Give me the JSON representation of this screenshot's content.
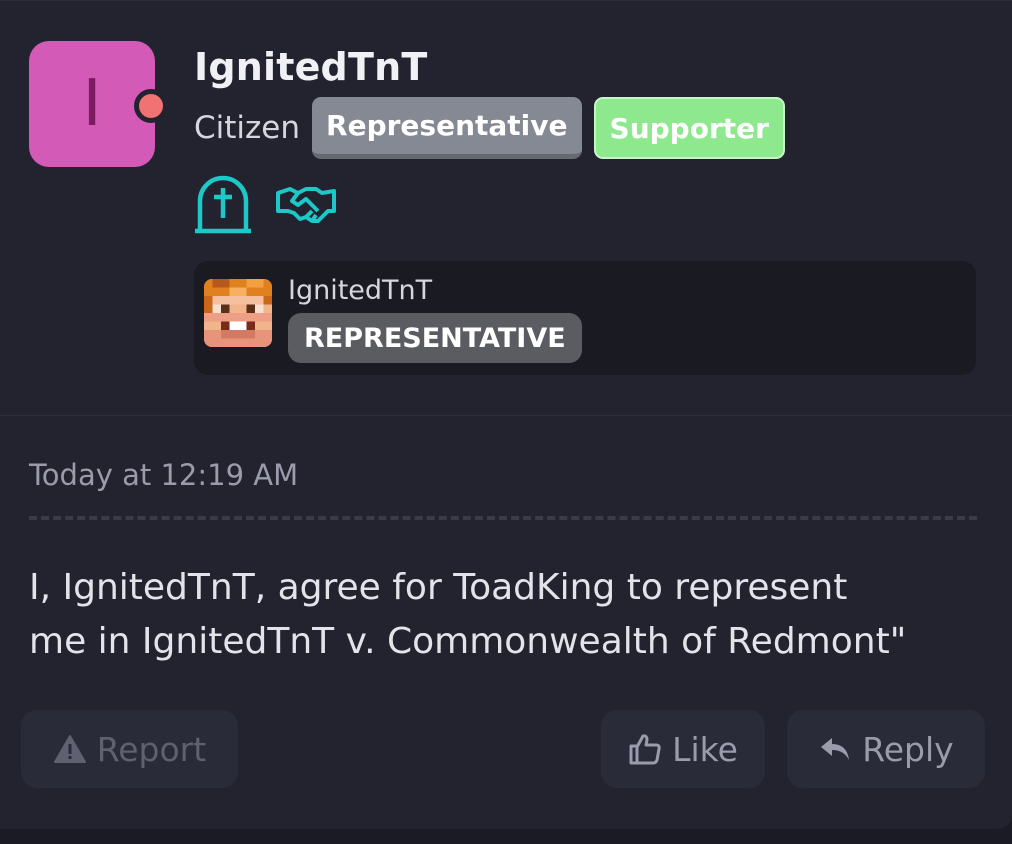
{
  "user": {
    "avatar_letter": "I",
    "username": "IgnitedTnT",
    "rank": "Citizen",
    "badges": [
      {
        "label": "Representative",
        "color": "#858993"
      },
      {
        "label": "Supporter",
        "color": "#8ee88e"
      }
    ],
    "trophy_icons": [
      "tombstone-cross-icon",
      "handshake-icon"
    ],
    "status_color": "#f07272",
    "avatar_color": "#d45ab8"
  },
  "embed": {
    "name": "IgnitedTnT",
    "badge": "REPRESENTATIVE",
    "head_icon": "minecraft-head-icon"
  },
  "post": {
    "timestamp": "Today at 12:19 AM",
    "body_line1": "I, IgnitedTnT, agree for ToadKing to represent",
    "body_line2": "me in IgnitedTnT v. Commonwealth of Redmont\""
  },
  "actions": {
    "report_label": "Report",
    "like_label": "Like",
    "reply_label": "Reply"
  },
  "colors": {
    "accent_teal": "#1cc8c8",
    "background": "#22232f"
  }
}
